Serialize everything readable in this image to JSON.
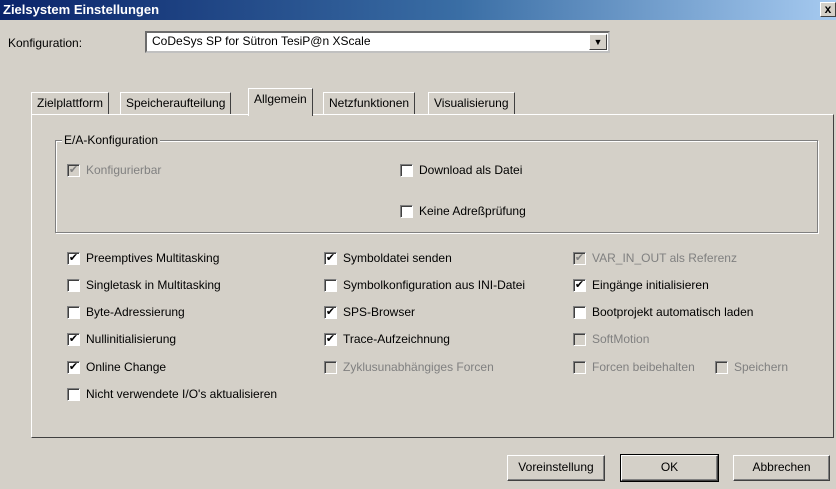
{
  "window": {
    "title": "Zielsystem Einstellungen",
    "close_label": "x"
  },
  "config": {
    "label": "Konfiguration:",
    "value": "CoDeSys SP for Sütron TesiP@n XScale",
    "dropdown_glyph": "▼"
  },
  "tabs": [
    {
      "label": "Zielplattform",
      "active": false
    },
    {
      "label": "Speicheraufteilung",
      "active": false
    },
    {
      "label": "Allgemein",
      "active": true
    },
    {
      "label": "Netzfunktionen",
      "active": false
    },
    {
      "label": "Visualisierung",
      "active": false
    }
  ],
  "io_group": {
    "title": "E/A-Konfiguration",
    "items": [
      {
        "label": "Konfigurierbar",
        "checked": true,
        "enabled": false
      },
      {
        "label": "Download als Datei",
        "checked": false,
        "enabled": true
      },
      {
        "label": "Keine Adreßprüfung",
        "checked": false,
        "enabled": true
      }
    ]
  },
  "options": {
    "col1": [
      {
        "label": "Preemptives Multitasking",
        "checked": true,
        "enabled": true
      },
      {
        "label": "Singletask in Multitasking",
        "checked": false,
        "enabled": true
      },
      {
        "label": "Byte-Adressierung",
        "checked": false,
        "enabled": true
      },
      {
        "label": "Nullinitialisierung",
        "checked": true,
        "enabled": true
      },
      {
        "label": "Online Change",
        "checked": true,
        "enabled": true
      },
      {
        "label": "Nicht verwendete I/O's aktualisieren",
        "checked": false,
        "enabled": true
      }
    ],
    "col2": [
      {
        "label": "Symboldatei senden",
        "checked": true,
        "enabled": true
      },
      {
        "label": "Symbolkonfiguration aus INI-Datei",
        "checked": false,
        "enabled": true
      },
      {
        "label": "SPS-Browser",
        "checked": true,
        "enabled": true
      },
      {
        "label": "Trace-Aufzeichnung",
        "checked": true,
        "enabled": true
      },
      {
        "label": "Zyklusunabhängiges Forcen",
        "checked": false,
        "enabled": false
      }
    ],
    "col3": [
      {
        "label": "VAR_IN_OUT als Referenz",
        "checked": true,
        "enabled": false
      },
      {
        "label": "Eingänge initialisieren",
        "checked": true,
        "enabled": true
      },
      {
        "label": "Bootprojekt automatisch laden",
        "checked": false,
        "enabled": true
      },
      {
        "label": "SoftMotion",
        "checked": false,
        "enabled": false
      },
      {
        "label": "Forcen beibehalten",
        "checked": false,
        "enabled": false
      },
      {
        "label": "Speichern",
        "checked": false,
        "enabled": false
      }
    ]
  },
  "buttons": {
    "default_settings": "Voreinstellung",
    "ok": "OK",
    "cancel": "Abbrechen"
  },
  "check_glyph": "✔"
}
